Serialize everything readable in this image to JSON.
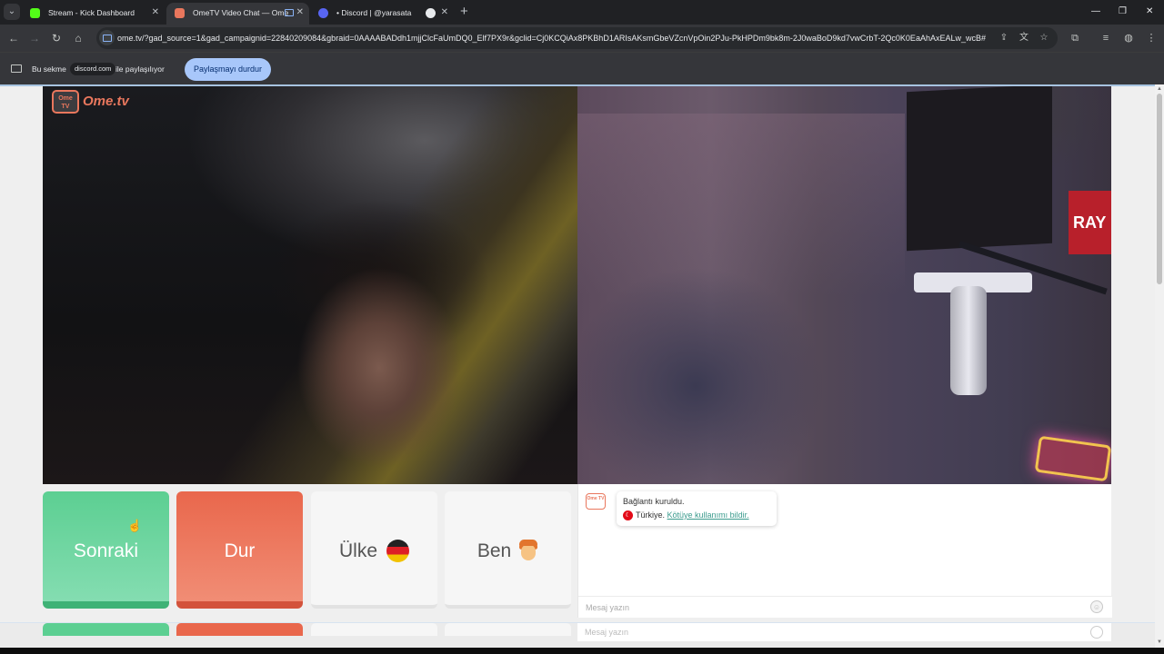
{
  "browser": {
    "tabs": [
      {
        "title": "Stream - Kick Dashboard",
        "active": false,
        "favicon_color": "#53fc18"
      },
      {
        "title": "OmeTV Video Chat — Ome",
        "active": true,
        "favicon_color": "#e9775d"
      },
      {
        "title": "• Discord | @yarasata",
        "active": false,
        "favicon_color": "#5865f2"
      },
      {
        "title": "",
        "active": false,
        "favicon_color": "#e8eaed"
      }
    ],
    "url": "ome.tv/?gad_source=1&gad_campaignid=22840209084&gbraid=0AAAABADdh1mjjClcFaUmDQ0_Elf7PX9r&gclid=Cj0KCQiAx8PKBhD1ARIsAKsmGbeVZcnVpOin2PJu-PkHPDm9bk8m-2J0waBoD9kd7vwCrbT-2Qc0K0EaAhAxEALw_wcB#"
  },
  "share_bar": {
    "text_before": "Bu sekme",
    "domain": "discord.com",
    "text_after": "ile paylaşılıyor",
    "stop_button": "Paylaşmayı durdur"
  },
  "ome": {
    "logo_icon_text": "Ome TV",
    "logo_text": "Ome.tv",
    "remote_sign_text": "RAY",
    "buttons": {
      "next": "Sonraki",
      "stop": "Dur",
      "country": "Ülke",
      "me": "Ben"
    },
    "chat": {
      "connected": "Bağlantı kuruldu.",
      "country": "Türkiye.",
      "report": "Kötüye kullanımı bildir.",
      "input_placeholder": "Mesaj yazın"
    }
  },
  "colors": {
    "next": "#5ccf92",
    "stop": "#e9674c",
    "brand": "#e9775d",
    "report_link": "#3b9b8d"
  }
}
